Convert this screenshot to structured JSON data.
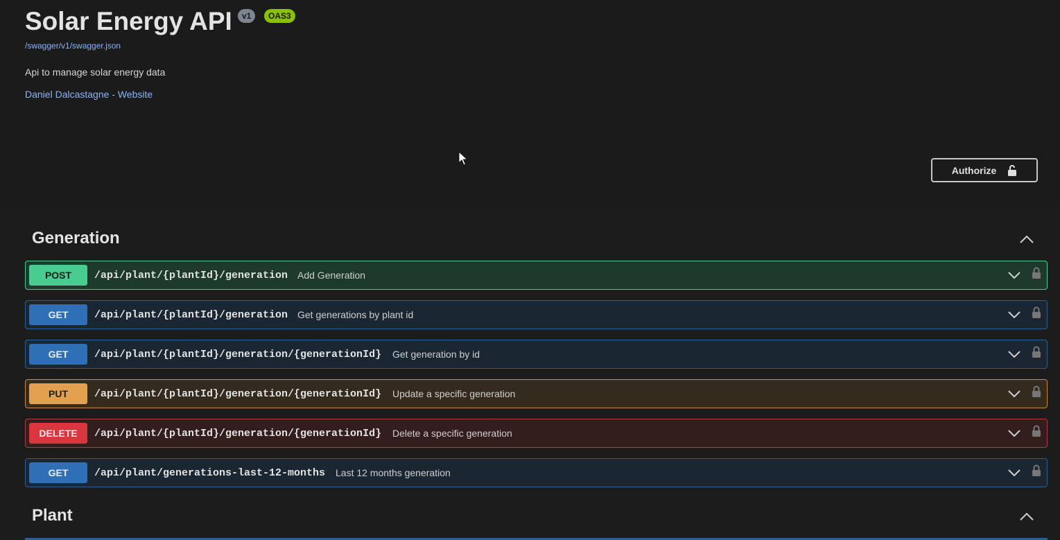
{
  "info": {
    "title": "Solar Energy API",
    "version_badge": "v1",
    "oas_badge": "OAS3",
    "spec_link": "/swagger/v1/swagger.json",
    "description": "Api to manage solar energy data",
    "contact_link": "Daniel Dalcastagne - Website"
  },
  "authorize": {
    "label": "Authorize"
  },
  "sections": [
    {
      "name": "Generation",
      "expanded": true,
      "operations": [
        {
          "method": "POST",
          "path": "/api/plant/{plantId}/generation",
          "summary": "Add Generation"
        },
        {
          "method": "GET",
          "path": "/api/plant/{plantId}/generation",
          "summary": "Get generations by plant id"
        },
        {
          "method": "GET",
          "path": "/api/plant/{plantId}/generation/{generationId}",
          "summary": "Get generation by id"
        },
        {
          "method": "PUT",
          "path": "/api/plant/{plantId}/generation/{generationId}",
          "summary": "Update a specific generation"
        },
        {
          "method": "DELETE",
          "path": "/api/plant/{plantId}/generation/{generationId}",
          "summary": "Delete a specific generation"
        },
        {
          "method": "GET",
          "path": "/api/plant/generations-last-12-months",
          "summary": "Last 12 months generation"
        }
      ]
    },
    {
      "name": "Plant",
      "expanded": true,
      "operations": []
    }
  ],
  "colors": {
    "post": "#49cc90",
    "get": "#2f6fb5",
    "put": "#e2a14e",
    "delete": "#d9363e",
    "link": "#8ab4f8"
  },
  "icons": {
    "authorize": "unlocked-padlock-icon",
    "operation_lock": "padlock-icon",
    "expand": "chevron-down-icon",
    "collapse": "chevron-up-icon",
    "cursor": "mouse-pointer-icon"
  }
}
